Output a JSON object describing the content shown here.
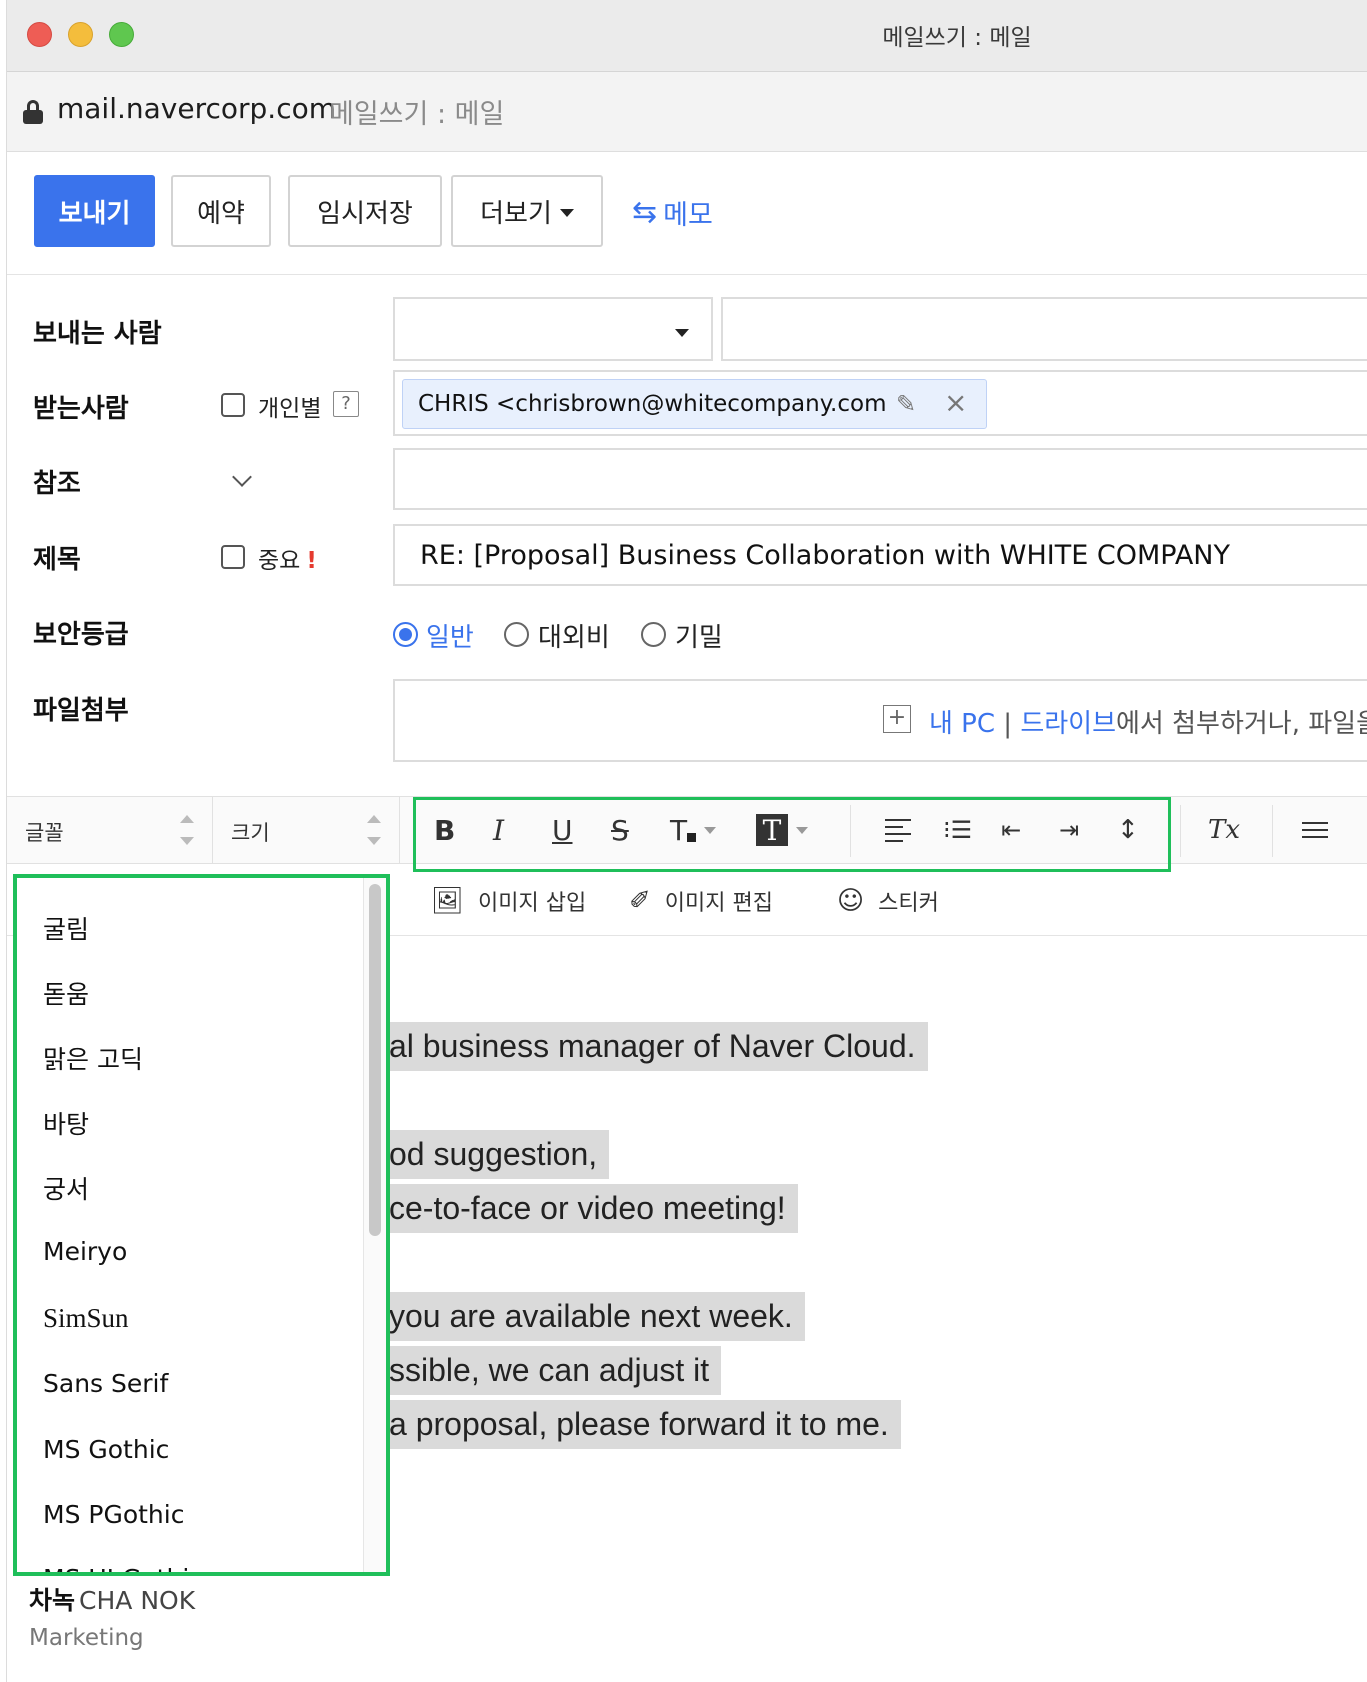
{
  "window": {
    "title": "메일쓰기 : 메일"
  },
  "address_bar": {
    "domain": "mail.navercorp.com",
    "page_title": "메일쓰기 : 메일"
  },
  "toolbar": {
    "send": "보내기",
    "reserve": "예약",
    "draft": "임시저장",
    "more": "더보기",
    "memo": "메모"
  },
  "form": {
    "from_label": "보내는 사람",
    "to_label": "받는사람",
    "individual_label": "개인별",
    "help": "?",
    "recipient": "CHRIS <chrisbrown@whitecompany.com",
    "cc_label": "참조",
    "subject_label": "제목",
    "important_label": "중요",
    "important_mark": "!",
    "subject_value": "RE: [Proposal] Business Collaboration with WHITE COMPANY",
    "security_label": "보안등급",
    "security_options": [
      "일반",
      "대외비",
      "기밀"
    ],
    "attach_label": "파일첨부",
    "attach_my_pc": "내 PC",
    "attach_sep": "|",
    "attach_drive": "드라이브",
    "attach_rest": "에서 첨부하거나, 파일을"
  },
  "editor_toolbar": {
    "font_label": "글꼴",
    "size_label": "크기",
    "bold": "B",
    "italic": "I",
    "underline": "U",
    "strike": "S",
    "text_color": "T",
    "bg_color": "T",
    "clear_format": "Tx",
    "insert_image": "이미지 삽입",
    "edit_image": "이미지 편집",
    "sticker": "스티커"
  },
  "font_dropdown": {
    "items": [
      "굴림",
      "돋움",
      "맑은 고딕",
      "바탕",
      "궁서",
      "Meiryo",
      "SimSun",
      "Sans Serif",
      "MS Gothic",
      "MS PGothic",
      "MS UI Gothic"
    ]
  },
  "body_lines": [
    "al business manager of Naver Cloud.",
    "od suggestion,",
    "ce-to-face or video meeting!",
    "you are available next week.",
    "ssible, we can adjust it",
    " a proposal, please forward it to me."
  ],
  "signature": {
    "name_ko": "차녹",
    "name_en": "CHA NOK",
    "department": "Marketing"
  },
  "colors": {
    "accent": "#3a73ec",
    "highlight": "#1fbf5a",
    "selection": "#dadada"
  }
}
